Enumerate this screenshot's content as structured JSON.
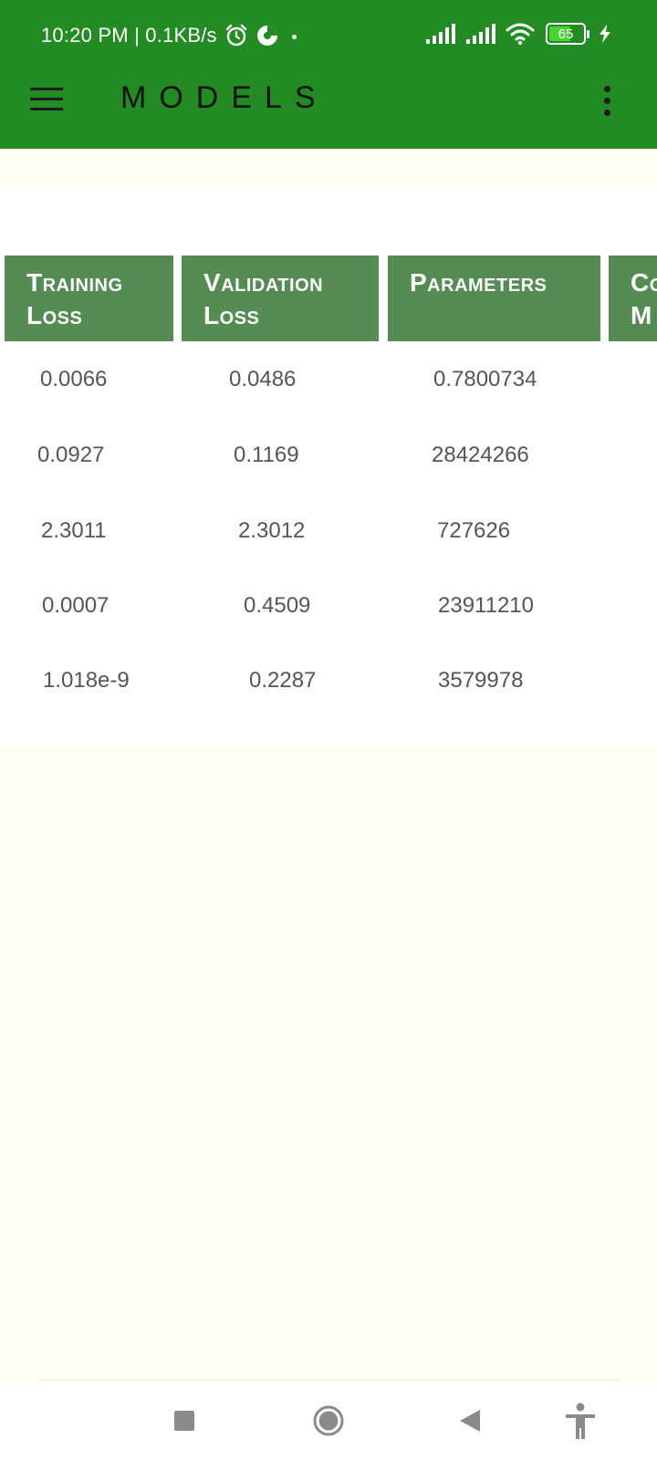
{
  "status_bar": {
    "time": "10:20 PM | 0.1KB/s",
    "battery_level": "65",
    "icons": [
      "alarm-icon",
      "data-saver-icon",
      "signal-icon",
      "signal-icon",
      "wifi-icon",
      "battery-icon",
      "bolt-icon"
    ]
  },
  "app_bar": {
    "title": "MODELS",
    "menu_icon": "hamburger-menu-icon",
    "overflow_icon": "more-vertical-icon",
    "background": "#228b22"
  },
  "table": {
    "headers": [
      "Training Loss",
      "Validation Loss",
      "Parameters",
      "Co M"
    ],
    "rows": [
      [
        "0.0066",
        "0.0486",
        "0.7800734"
      ],
      [
        "0.0927",
        "0.1169",
        "28424266"
      ],
      [
        "2.3011",
        "2.3012",
        "727626"
      ],
      [
        "0.0007",
        "0.4509",
        "23911210"
      ],
      [
        "1.018e-9",
        "0.2287",
        "3579978"
      ]
    ],
    "header_color": "#548c54"
  },
  "nav_bar": {
    "buttons": [
      "recents-square-icon",
      "home-circle-icon",
      "back-triangle-icon",
      "accessibility-icon"
    ]
  }
}
